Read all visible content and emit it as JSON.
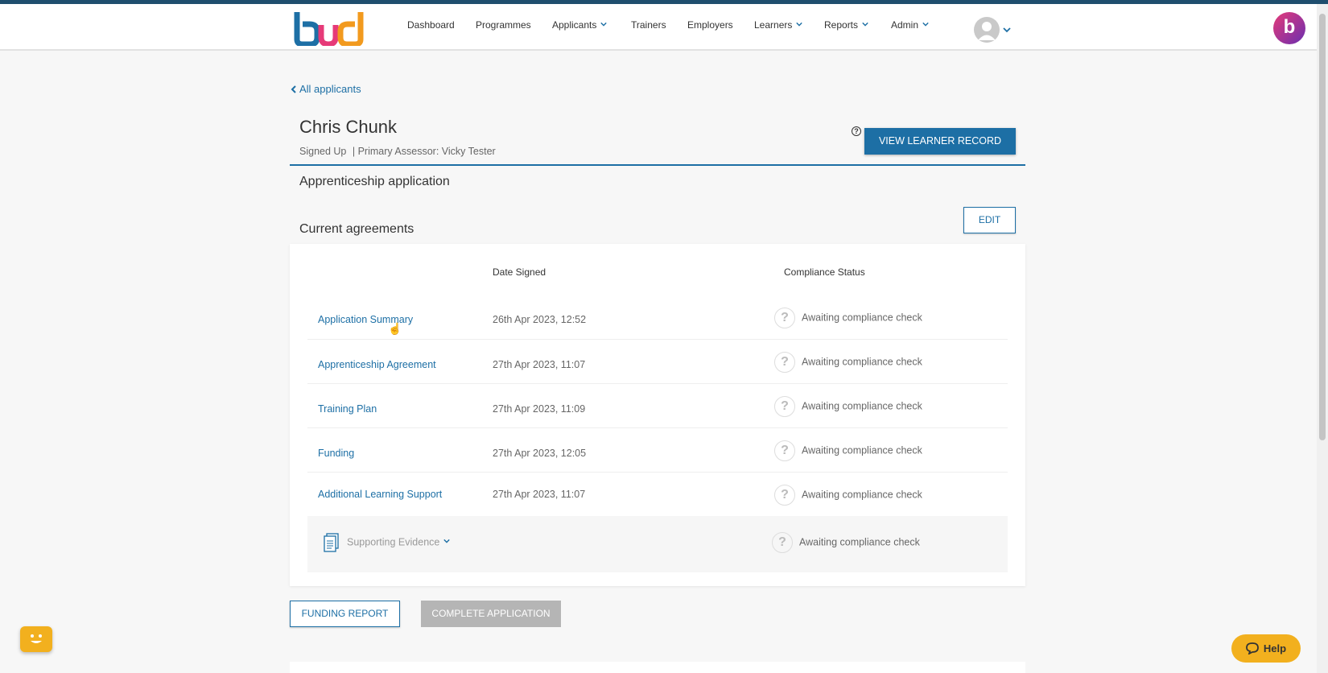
{
  "brand": {
    "logo_text": "bud",
    "badge_letter": "b"
  },
  "nav": {
    "items": [
      {
        "label": "Dashboard",
        "dropdown": false
      },
      {
        "label": "Programmes",
        "dropdown": false
      },
      {
        "label": "Applicants",
        "dropdown": true
      },
      {
        "label": "Trainers",
        "dropdown": false
      },
      {
        "label": "Employers",
        "dropdown": false
      },
      {
        "label": "Learners",
        "dropdown": true
      },
      {
        "label": "Reports",
        "dropdown": true
      },
      {
        "label": "Admin",
        "dropdown": true
      }
    ]
  },
  "breadcrumb": {
    "back_label": "All applicants"
  },
  "applicant": {
    "name": "Chris Chunk",
    "status": "Signed Up",
    "assessor": "| Primary Assessor: Vicky Tester"
  },
  "actions": {
    "help_label": "?",
    "view_learner_record": "VIEW LEARNER RECORD",
    "edit": "EDIT",
    "funding_report": "FUNDING REPORT",
    "complete_application": "COMPLETE APPLICATION"
  },
  "sections": {
    "application_title": "Apprenticeship application",
    "agreements_title": "Current agreements"
  },
  "table": {
    "headers": {
      "date": "Date Signed",
      "status": "Compliance Status"
    },
    "rows": [
      {
        "name": "Application Summary",
        "date": "26th Apr 2023, 12:52",
        "status": "Awaiting compliance check"
      },
      {
        "name": "Apprenticeship Agreement",
        "date": "27th Apr 2023, 11:07",
        "status": "Awaiting compliance check"
      },
      {
        "name": "Training Plan",
        "date": "27th Apr 2023, 11:09",
        "status": "Awaiting compliance check"
      },
      {
        "name": "Funding",
        "date": "27th Apr 2023, 12:05",
        "status": "Awaiting compliance check"
      },
      {
        "name": "Additional Learning Support",
        "date": "27th Apr 2023, 11:07",
        "status": "Awaiting compliance check"
      }
    ],
    "evidence": {
      "label": "Supporting Evidence",
      "status": "Awaiting compliance check"
    }
  },
  "help_widget": {
    "label": "Help"
  },
  "colors": {
    "accent": "#1d6fa5",
    "help": "#f2b01e",
    "top_strip": "#1f4e6e"
  }
}
